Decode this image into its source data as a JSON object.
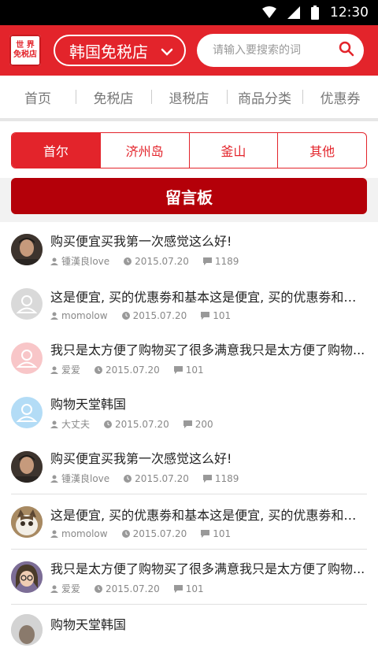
{
  "status": {
    "time": "12:30"
  },
  "header": {
    "logo_line1": "世 界",
    "logo_line2": "免税店",
    "store": "韩国免税店",
    "search_placeholder": "请输入要搜索的词"
  },
  "nav": {
    "items": [
      "首页",
      "免税店",
      "退税店",
      "商品分类",
      "优惠券"
    ]
  },
  "tabs": {
    "items": [
      "首尔",
      "济州岛",
      "釜山",
      "其他"
    ],
    "active": 0
  },
  "board": {
    "label": "留言板"
  },
  "posts": [
    {
      "title": "购买便宜买我第一次感觉这么好!",
      "user": "锺漢良love",
      "date": "2015.07.20",
      "comments": "1189"
    },
    {
      "title": "这是便宜, 买的优惠劵和基本这是便宜, 买的优惠劵和基本",
      "user": "momolow",
      "date": "2015.07.20",
      "comments": "101"
    },
    {
      "title": "我只是太方便了购物买了很多满意我只是太方便了购物...",
      "user": "爱爱",
      "date": "2015.07.20",
      "comments": "101"
    },
    {
      "title": "购物天堂韩国",
      "user": "大丈夫",
      "date": "2015.07.20",
      "comments": "200"
    },
    {
      "title": "购买便宜买我第一次感觉这么好!",
      "user": "锺漢良love",
      "date": "2015.07.20",
      "comments": "1189"
    },
    {
      "title": "这是便宜, 买的优惠劵和基本这是便宜, 买的优惠劵和基本",
      "user": "momolow",
      "date": "2015.07.20",
      "comments": "101"
    },
    {
      "title": "我只是太方便了购物买了很多满意我只是太方便了购物...",
      "user": "爱爱",
      "date": "2015.07.20",
      "comments": "101"
    },
    {
      "title": "购物天堂韩国",
      "user": "",
      "date": "",
      "comments": ""
    }
  ],
  "colors": {
    "brand": "#e3242b",
    "board": "#b40009"
  }
}
